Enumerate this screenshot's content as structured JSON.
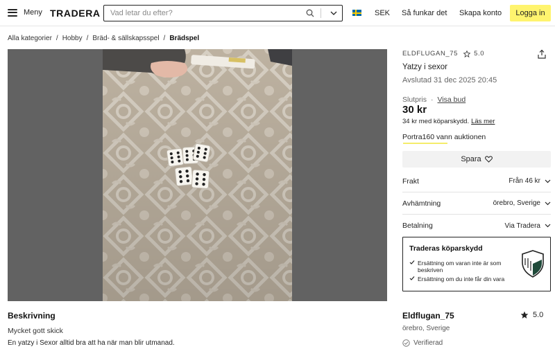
{
  "header": {
    "menu_label": "Meny",
    "logo": "TRADERA",
    "search_placeholder": "Vad letar du efter?",
    "currency": "SEK",
    "how_it_works": "Så funkar det",
    "create_account": "Skapa konto",
    "login": "Logga in",
    "icons": [
      "hamburger-icon",
      "search-icon",
      "chevron-down-icon",
      "sweden-flag-icon"
    ],
    "accent_color": "#fff46e"
  },
  "breadcrumb": [
    "Alla kategorier",
    "Hobby",
    "Bräd- & sällskapsspel",
    "Brädspel"
  ],
  "listing": {
    "seller_tag": "ELDFLUGAN_75",
    "seller_tag_rating": "5.0",
    "title": "Yatzy i sexor",
    "ended": "Avslutad 31 dec 2025 20:45",
    "final_price_label": "Slutpris",
    "view_bids": "Visa bud",
    "price": "30 kr",
    "price_with_protection": "34 kr med köparskydd.",
    "read_more": "Läs mer",
    "winner_text": "Portra160 vann auktionen",
    "save_label": "Spara"
  },
  "info_rows": [
    {
      "label": "Frakt",
      "value": "Från 46 kr"
    },
    {
      "label": "Avhämtning",
      "value": "örebro, Sverige"
    },
    {
      "label": "Betalning",
      "value": "Via Tradera"
    }
  ],
  "protection": {
    "title": "Traderas köparskydd",
    "items": [
      "Ersättning om varan inte är som beskriven",
      "Ersättning om du inte får din vara"
    ]
  },
  "description": {
    "title": "Beskrivning",
    "condition": "Mycket gott skick",
    "text": "En yatzy i Sexor alltid bra att ha när man blir utmanad."
  },
  "seller": {
    "name": "Eldflugan_75",
    "rating": "5.0",
    "location": "örebro, Sverige",
    "verified": "Verifierad"
  }
}
